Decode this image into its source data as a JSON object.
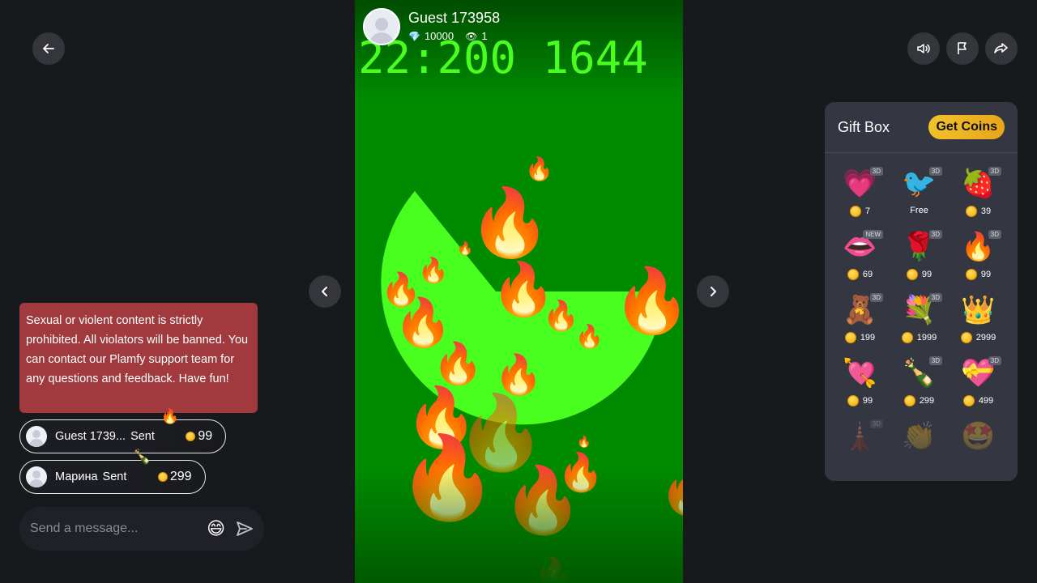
{
  "colors": {
    "background": "#18191d",
    "stream_green": "#008a00",
    "pie_green": "#48ff20",
    "notice_red": "#a03a3f",
    "giftbox_bg": "#343741",
    "coin_gold": "#f2b300"
  },
  "icons": {
    "back": "arrow-left-icon",
    "sound": "speaker-icon",
    "report": "flag-icon",
    "share": "share-icon",
    "prev": "chevron-left-icon",
    "next": "chevron-right-icon",
    "send": "send-icon"
  },
  "host": {
    "name": "Guest 173958",
    "diamonds": "10000",
    "viewers": "1",
    "diamond_icon": "💎",
    "eye_icon": "👁"
  },
  "stream": {
    "counter_text": "22:200 1644"
  },
  "notice": {
    "text": "Sexual or violent content is strictly prohibited. All violators will be banned. You can contact our Plamfy support team for any questions and feedback. Have fun!"
  },
  "chat": [
    {
      "name": "Guest 1739...",
      "action": "Sent",
      "gift": "🔥",
      "amount": "99"
    },
    {
      "name": "Марина",
      "action": "Sent",
      "gift": "🍾",
      "amount": "299"
    }
  ],
  "message": {
    "placeholder": "Send a message...",
    "emoji": "😄"
  },
  "giftbox": {
    "title": "Gift Box",
    "get_coins": "Get Coins",
    "gifts": [
      {
        "icon": "💗",
        "badge": "3D",
        "price": "7"
      },
      {
        "icon": "🐦",
        "badge": "3D",
        "price": "Free"
      },
      {
        "icon": "🍓",
        "badge": "3D",
        "price": "39"
      },
      {
        "icon": "👄",
        "badge": "NEW",
        "price": "69"
      },
      {
        "icon": "🌹",
        "badge": "3D",
        "price": "99"
      },
      {
        "icon": "🔥",
        "badge": "3D",
        "price": "99"
      },
      {
        "icon": "🧸",
        "badge": "3D",
        "price": "199"
      },
      {
        "icon": "💐",
        "badge": "3D",
        "price": "1999"
      },
      {
        "icon": "👑",
        "badge": "",
        "price": "2999"
      },
      {
        "icon": "💘",
        "badge": "",
        "price": "99"
      },
      {
        "icon": "🍾",
        "badge": "3D",
        "price": "299"
      },
      {
        "icon": "💝",
        "badge": "3D",
        "price": "499"
      },
      {
        "icon": "🗼",
        "badge": "3D",
        "price": ""
      },
      {
        "icon": "👏",
        "badge": "",
        "price": ""
      },
      {
        "icon": "🤩",
        "badge": "",
        "price": ""
      }
    ]
  }
}
